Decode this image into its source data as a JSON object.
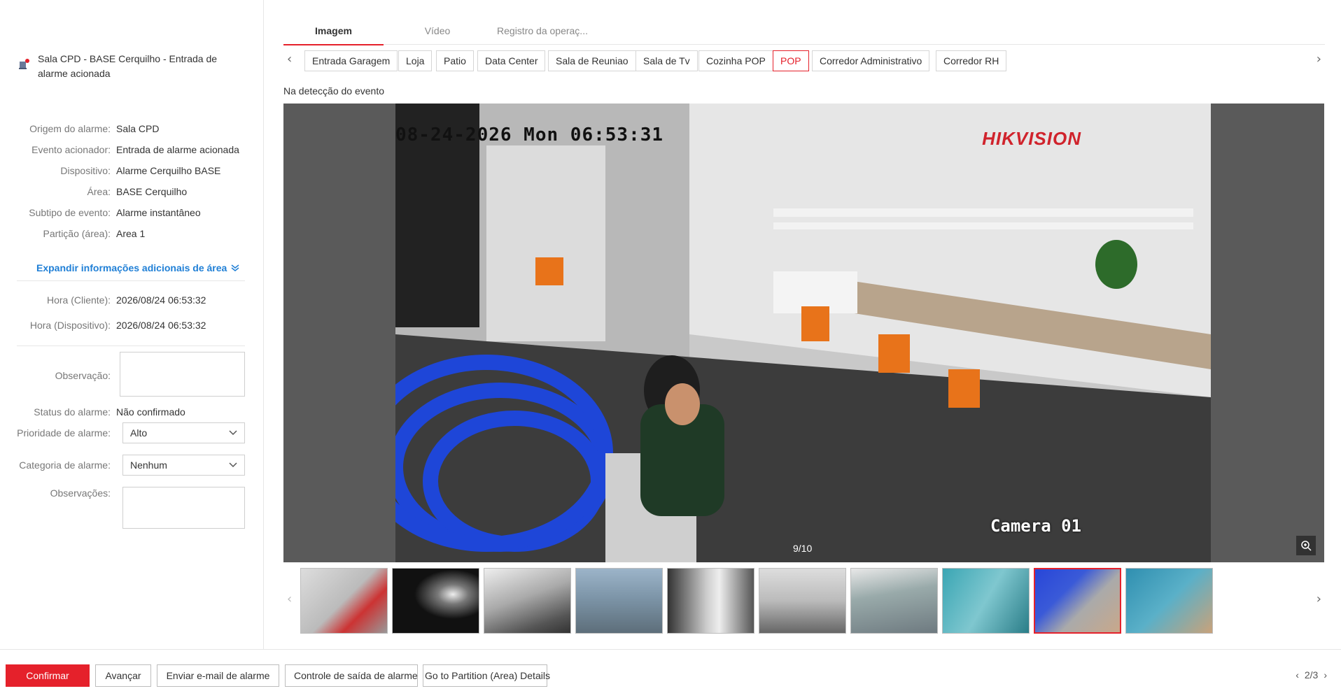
{
  "alarm": {
    "title": "Sala CPD - BASE Cerquilho - Entrada de alarme acionada",
    "fields": [
      {
        "label": "Origem do alarme:",
        "value": "Sala CPD"
      },
      {
        "label": "Evento acionador:",
        "value": "Entrada de alarme acionada"
      },
      {
        "label": "Dispositivo:",
        "value": "Alarme Cerquilho BASE"
      },
      {
        "label": "Área:",
        "value": "BASE Cerquilho"
      },
      {
        "label": "Subtipo de evento:",
        "value": "Alarme instantâneo"
      },
      {
        "label": "Partição (área):",
        "value": "Area 1"
      }
    ],
    "expand_label": "Expandir informações adicionais de área",
    "time_client_label": "Hora (Cliente):",
    "time_client": "2026/08/24 06:53:32",
    "time_device_label": "Hora (Dispositivo):",
    "time_device": "2026/08/24 06:53:32",
    "observation_label": "Observação:",
    "status_label": "Status do alarme:",
    "status_value": "Não confirmado",
    "priority_label": "Prioridade de alarme:",
    "priority_value": "Alto",
    "category_label": "Categoria de alarme:",
    "category_value": "Nenhum",
    "remarks_label": "Observações:"
  },
  "tabs": [
    {
      "label": "Imagem",
      "active": true
    },
    {
      "label": "Vídeo",
      "active": false
    },
    {
      "label": "Registro da operaç...",
      "active": false
    }
  ],
  "cameras": [
    "Entrada Garagem",
    "Loja",
    "Patio",
    "Data Center",
    "Sala de Reuniao",
    "Sala de Tv",
    "Cozinha POP",
    "POP",
    "Corredor Administrativo",
    "Corredor RH"
  ],
  "active_camera": "POP",
  "viewer": {
    "event_label": "Na detecção do evento",
    "timestamp": "08-24-2026 Mon 06:53:31",
    "brand": "HIKVISION",
    "camera_name": "Camera 01",
    "counter": "9/10"
  },
  "thumbnails": {
    "count": 10,
    "active_index": 8
  },
  "bottom": {
    "confirm": "Confirmar",
    "next": "Avançar",
    "email": "Enviar e-mail de alarme",
    "output": "Controle de saída de alarme",
    "partition": "Go to Partition (Area) Details",
    "page": "2/3"
  },
  "colors": {
    "accent": "#e5212b",
    "link": "#1f7fd6"
  }
}
